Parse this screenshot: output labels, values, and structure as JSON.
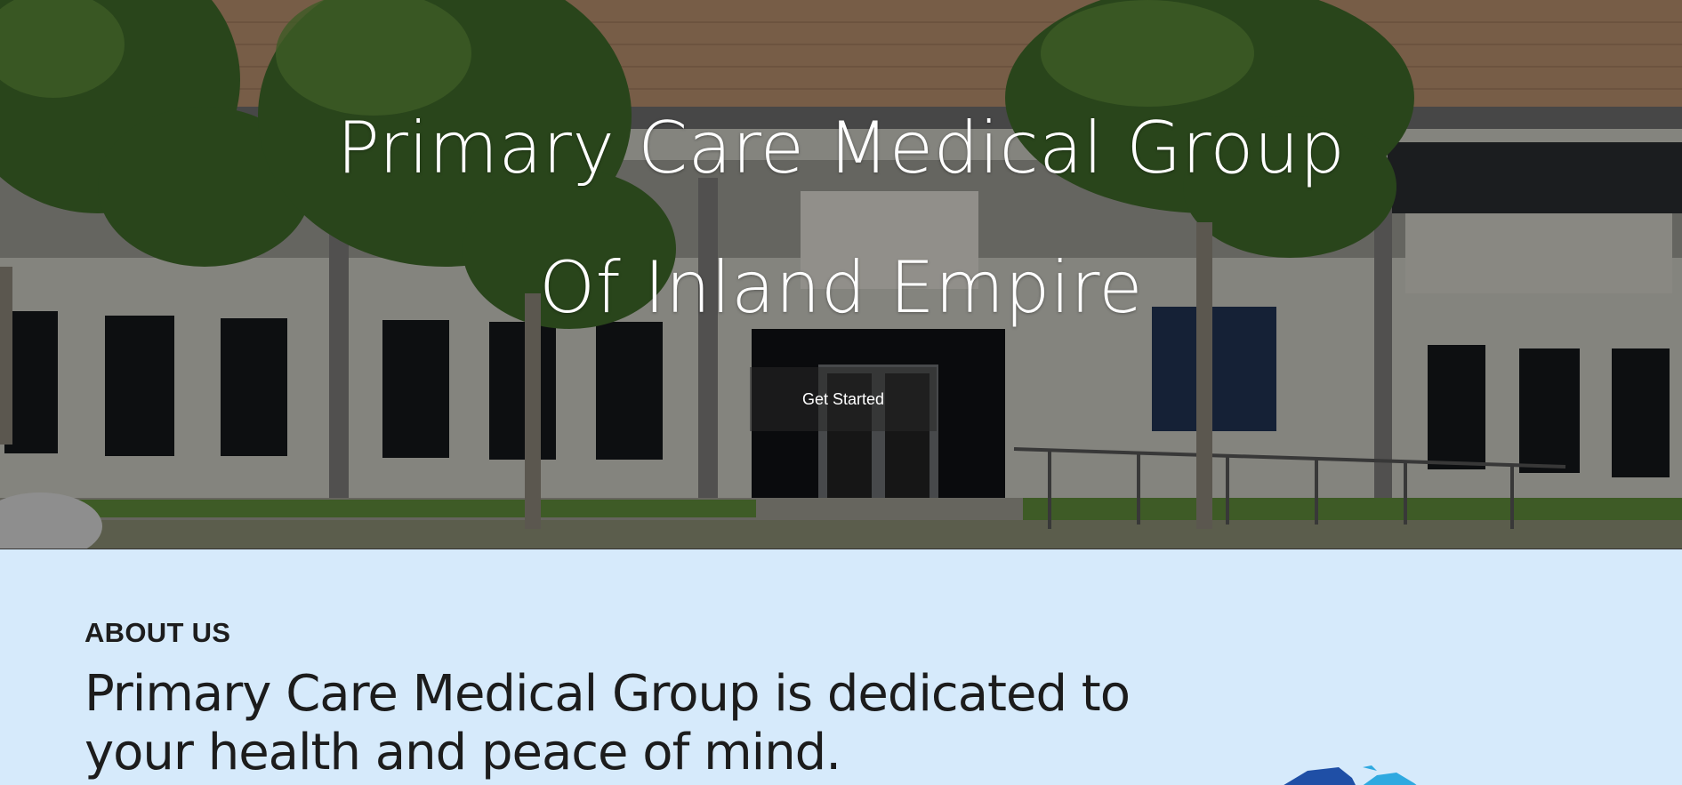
{
  "hero": {
    "title_line1": "Primary Care Medical Group",
    "title_line2": "Of Inland Empire",
    "cta_label": "Get Started",
    "background_image": "building-photo"
  },
  "about": {
    "eyebrow": "ABOUT US",
    "heading": "Primary Care Medical Group is dedicated to your health and peace of mind."
  },
  "colors": {
    "about_background": "#d6eafb",
    "hero_text": "#ffffff",
    "logo_dark_blue": "#1f4fa6",
    "logo_light_blue": "#2fa9e0"
  }
}
